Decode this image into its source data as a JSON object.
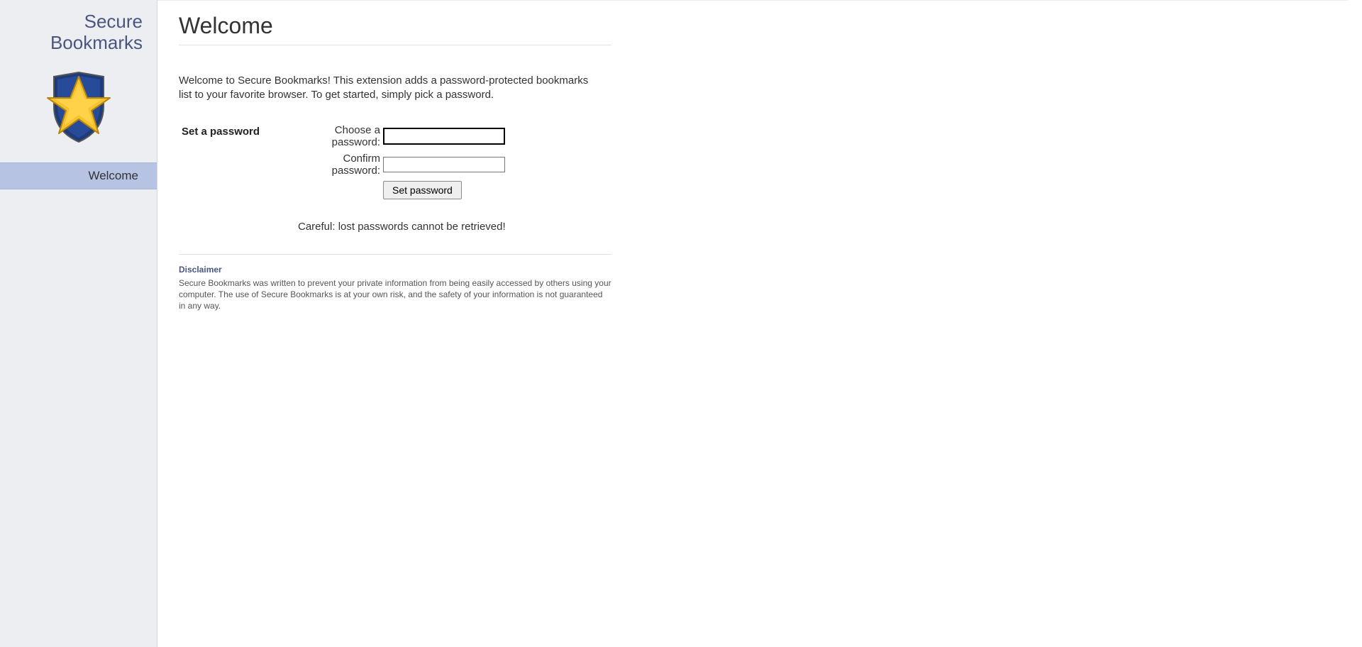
{
  "app": {
    "brand_line1": "Secure",
    "brand_line2": "Bookmarks"
  },
  "sidebar": {
    "items": [
      {
        "label": "Welcome"
      }
    ]
  },
  "main": {
    "title": "Welcome",
    "intro": "Welcome to Secure Bookmarks! This extension adds a password-protected bookmarks list to your favorite browser. To get started, simply pick a password.",
    "form": {
      "heading": "Set a password",
      "choose_label": "Choose a password:",
      "confirm_label": "Confirm password:",
      "choose_value": "",
      "confirm_value": "",
      "submit_label": "Set password",
      "warning": "Careful: lost passwords cannot be retrieved!"
    },
    "disclaimer": {
      "heading": "Disclaimer",
      "body": "Secure Bookmarks was written to prevent your private information from being easily accessed by others using your computer. The use of Secure Bookmarks is at your own risk, and the safety of your information is not guaranteed in any way."
    }
  }
}
